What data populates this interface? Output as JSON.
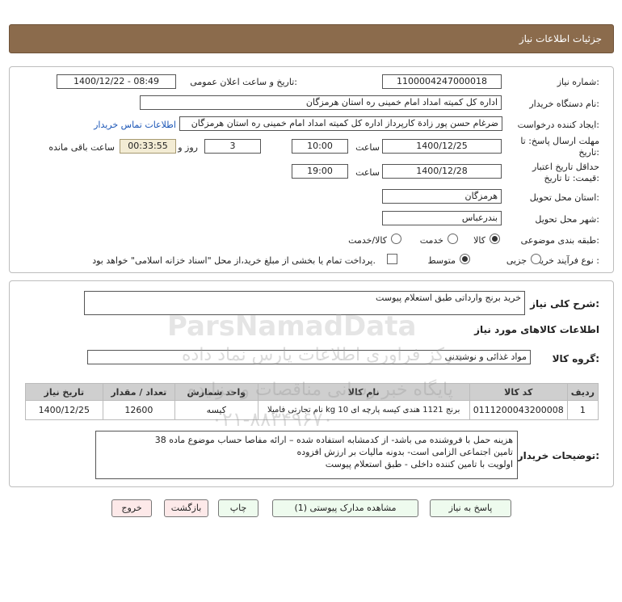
{
  "header": {
    "title": "جزئیات اطلاعات نیاز"
  },
  "form": {
    "need_number_label": "شماره نیاز:",
    "need_number": "1100004247000018",
    "announce_label": "تاریخ و ساعت اعلان عمومی:",
    "announce_value": "1400/12/22 - 08:49",
    "buyer_org_label": "نام دستگاه خریدار:",
    "buyer_org": "اداره کل کمیته امداد امام خمینی  ره  استان هرمزگان",
    "creator_label": "ایجاد کننده درخواست:",
    "creator": "ضرغام حسن پور زادة کارپرداز اداره کل کمیته امداد امام خمینی  ره  استان هرمزگان",
    "contact_link": "اطلاعات تماس خریدار",
    "deadline_label_1": "مهلت ارسال پاسخ: تا",
    "deadline_label_2": "تاریخ:",
    "deadline_date": "1400/12/25",
    "time_label": "ساعت",
    "deadline_time": "10:00",
    "days_value": "3",
    "days_label": "روز و",
    "remaining_value": "00:33:55",
    "remaining_label": "ساعت باقی مانده",
    "validity_label_1": "حداقل تاریخ اعتبار",
    "validity_label_2": "قیمت: تا تاریخ:",
    "validity_date": "1400/12/28",
    "validity_time": "19:00",
    "province_label": "استان محل تحویل:",
    "province": "هرمزگان",
    "city_label": "شهر محل تحویل:",
    "city": "بندرعباس",
    "category_label": "طبقه بندی موضوعی:",
    "category_options": [
      "کالا",
      "خدمت",
      "کالا/خدمت"
    ],
    "process_label": "نوع فرآیند خرید :",
    "process_options": [
      "جزیی",
      "متوسط"
    ],
    "payment_note": "پرداخت تمام یا بخشی از مبلغ خرید،از محل \"اسناد خزانه اسلامی\" خواهد بود."
  },
  "description": {
    "label": "شرح کلی نیاز:",
    "value": "خرید برنج وارداتی طبق استعلام پیوست"
  },
  "goods": {
    "section_title": "اطلاعات کالاهای مورد نیاز",
    "group_label": "گروه کالا:",
    "group_value": "مواد غذائی و نوشیدنی",
    "columns": [
      "ردیف",
      "کد کالا",
      "نام کالا",
      "واحد شمارش",
      "تعداد / مقدار",
      "تاریخ نیاز"
    ],
    "rows": [
      [
        "1",
        "0111200043200008",
        "برنج 1121 هندی کیسه پارچه ای 10 kg نام تجارتی فامیلا",
        "کیسه",
        "12600",
        "1400/12/25"
      ]
    ]
  },
  "buyer_notes": {
    "label": "توضیحات خریدار:",
    "lines": [
      "هزینه حمل با فروشنده می باشد- از کدمشابه استفاده شده – ارائه مفاصا حساب موضوع ماده 38",
      "تامین اجتماعی الزامی است- بدونه مالیات بر ارزش افزوده",
      "اولویت  با تامین کننده داخلی  - طبق استعلام پیوست"
    ]
  },
  "buttons": {
    "reply": "پاسخ به نیاز",
    "attachments": "مشاهده مدارک پیوستی (1)",
    "print": "چاپ",
    "back": "بازگشت",
    "exit": "خروج"
  },
  "watermark": {
    "brand": "ParsNamadData",
    "line1": "مرکز فراوری اطلاعات پارس نماد داده",
    "line2": "پایگاه خبر رسانی مناقصات و مزایده",
    "phone": "۰۲۱-۸۸۳۴۹۶۷۰"
  }
}
